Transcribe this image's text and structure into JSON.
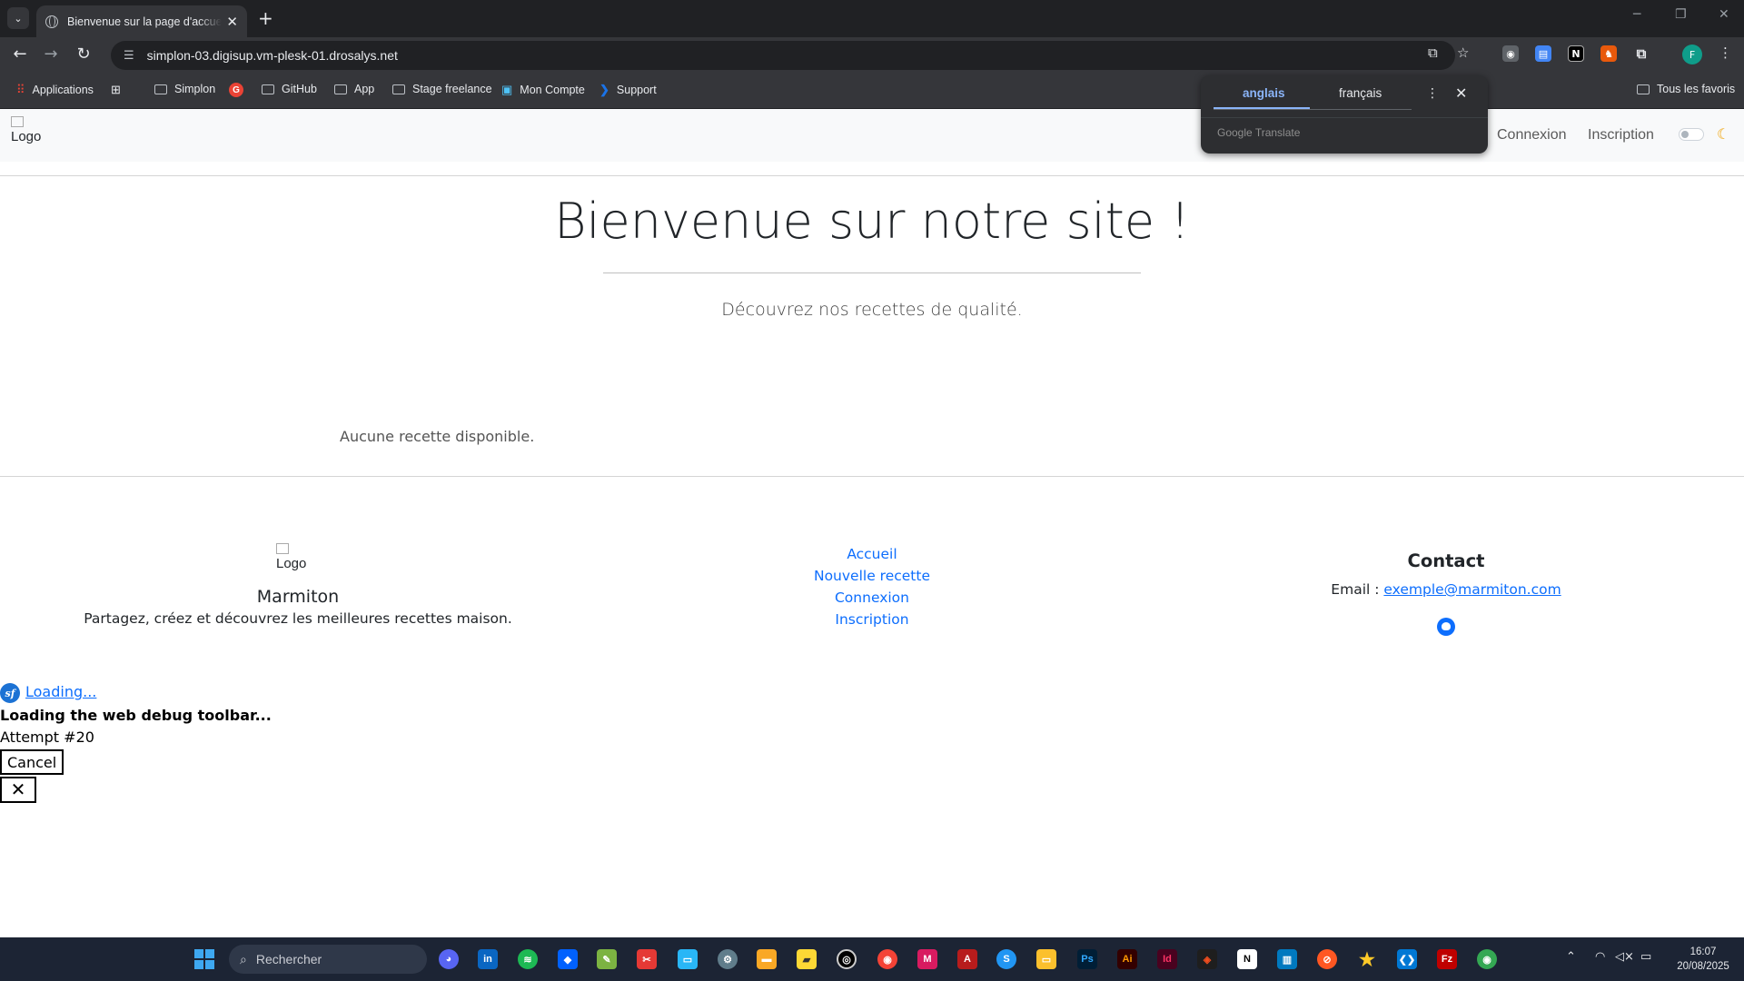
{
  "browser": {
    "tab_title": "Bienvenue sur la page d'accueil",
    "url": "simplon-03.digisup.vm-plesk-01.drosalys.net",
    "profile_initial": "F",
    "bookmarks": [
      "Applications",
      "Simplon",
      "GitHub",
      "App",
      "Stage freelance",
      "Mon Compte",
      "Support"
    ],
    "all_bookmarks": "Tous les favoris"
  },
  "translate": {
    "source_lang": "anglais",
    "target_lang": "français",
    "brand": "Google Translate"
  },
  "header": {
    "logo_alt": "Logo",
    "nav": {
      "login": "Connexion",
      "register": "Inscription"
    }
  },
  "hero": {
    "title": "Bienvenue sur notre site !",
    "subtitle": "Découvrez nos recettes de qualité."
  },
  "recipes": {
    "empty_message": "Aucune recette disponible."
  },
  "footer": {
    "logo_alt": "Logo",
    "brand": "Marmiton",
    "tagline": "Partagez, créez et découvrez les meilleures recettes maison.",
    "links": [
      "Accueil",
      "Nouvelle recette",
      "Connexion",
      "Inscription"
    ],
    "contact_title": "Contact",
    "email_label": "Email :",
    "email": "exemple@marmiton.com"
  },
  "debug": {
    "badge": "sf",
    "loading": "Loading...",
    "message": "Loading the web debug toolbar...",
    "attempt": "Attempt #20",
    "cancel": "Cancel",
    "close": "✕"
  },
  "taskbar": {
    "search_placeholder": "Rechercher",
    "time": "16:07",
    "date": "20/08/2025"
  }
}
